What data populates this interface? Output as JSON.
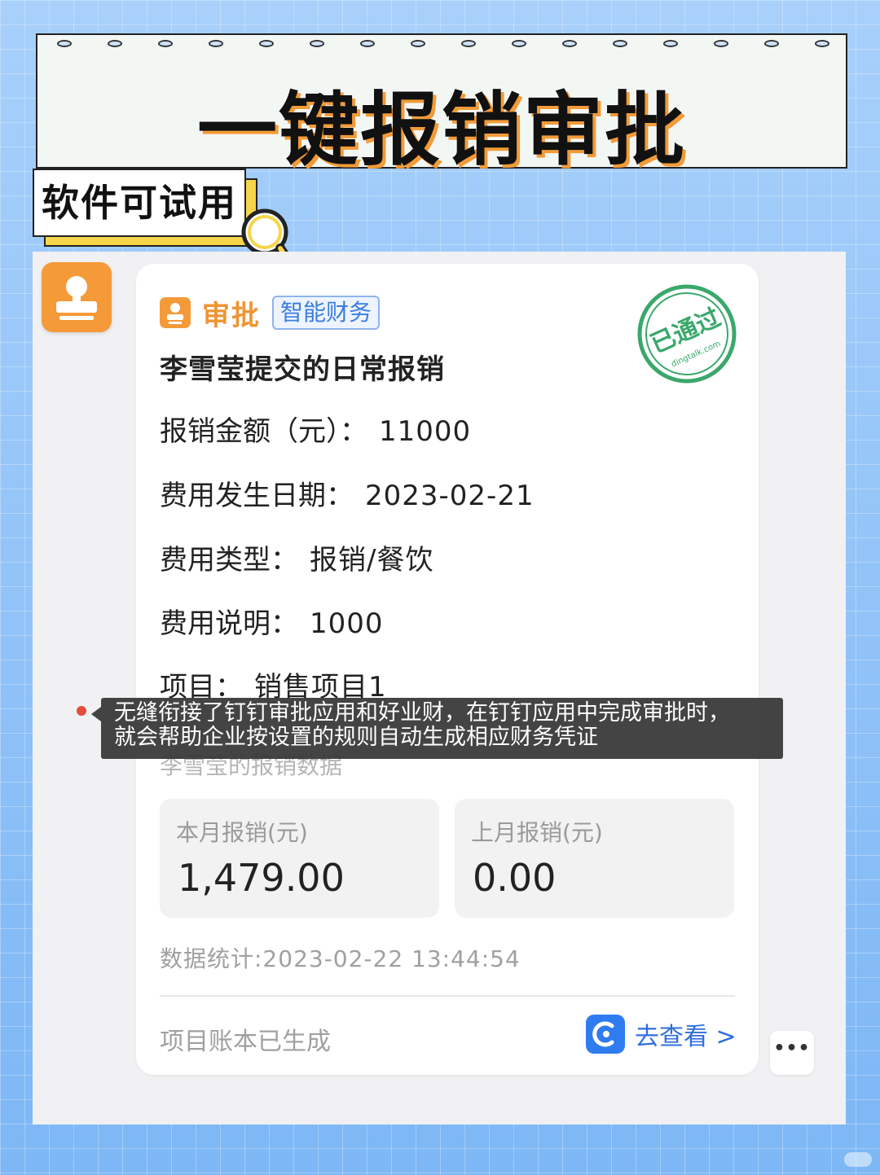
{
  "banner": {
    "title": "一键报销审批"
  },
  "tag": {
    "label": "软件可试用"
  },
  "card": {
    "app_name": "审批",
    "badge": "智能财务",
    "stamp_text": "已通过",
    "stamp_domain": "dingtalk.com",
    "title": "李雪莹提交的日常报销",
    "fields": [
      {
        "label": "报销金额（元）：",
        "value": "11000"
      },
      {
        "label": "费用发生日期：",
        "value": "2023-02-21"
      },
      {
        "label": "费用类型：",
        "value": "报销/餐饮"
      },
      {
        "label": "费用说明：",
        "value": "1000"
      },
      {
        "label": "项目：",
        "value": "销售项目1"
      }
    ],
    "hidden_line": "李雪莹的报销数据",
    "stats": [
      {
        "label": "本月报销(元)",
        "value": "1,479.00"
      },
      {
        "label": "上月报销(元)",
        "value": "0.00"
      }
    ],
    "stat_time": "数据统计:2023-02-22 13:44:54",
    "footer_note": "项目账本已生成",
    "view_link": "去查看 >",
    "more": "•••"
  },
  "subtitle": {
    "line1": "无缝衔接了钉钉审批应用和好业财，在钉钉应用中完成审批时，",
    "line2": "就会帮助企业按设置的规则自动生成相应财务凭证"
  },
  "colors": {
    "accent_orange": "#f59a38",
    "link_blue": "#2f7cf0",
    "stamp_green": "#3aa86a",
    "background_blue": "#8fc2f8"
  }
}
